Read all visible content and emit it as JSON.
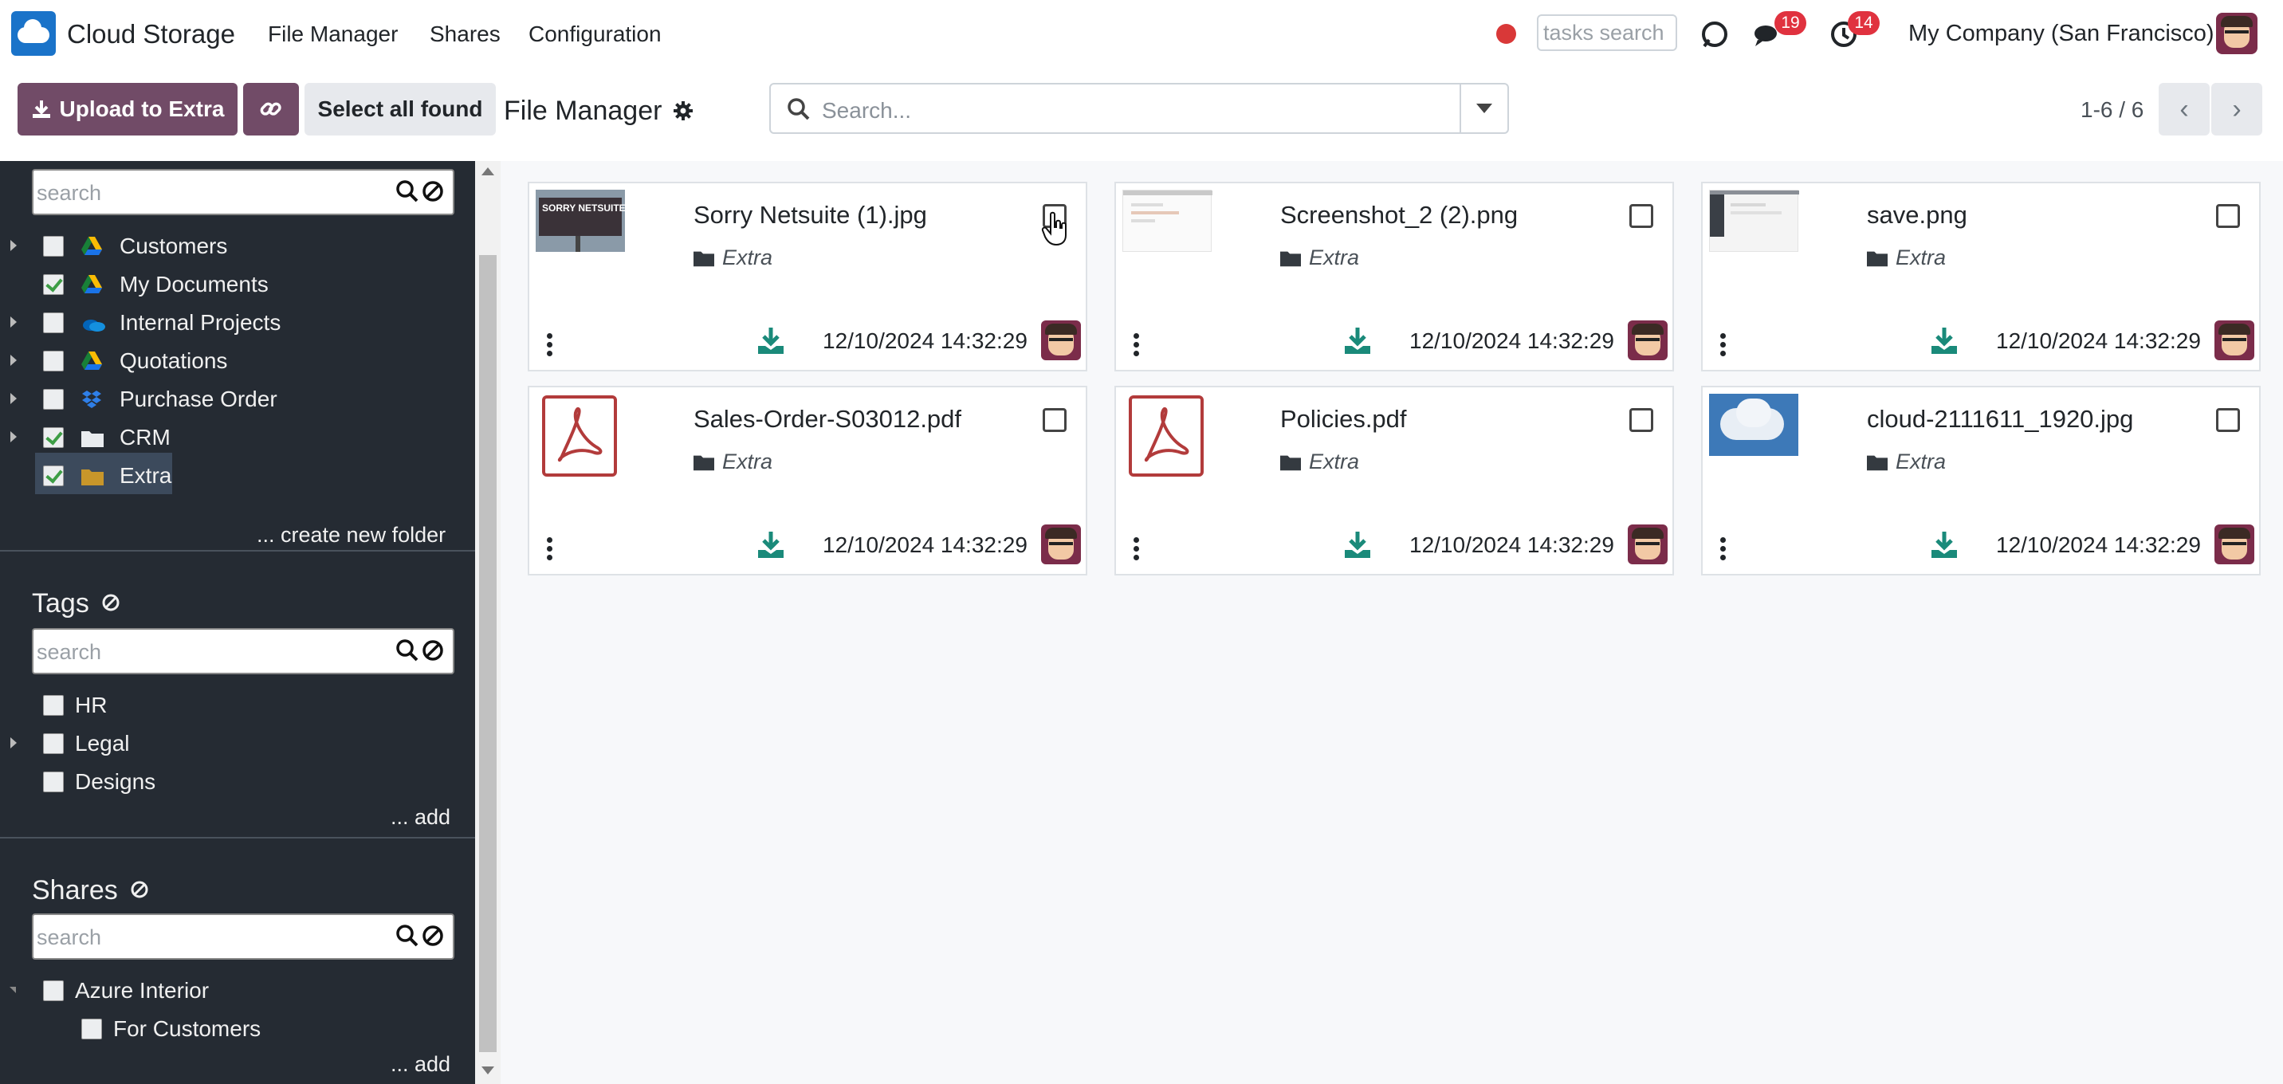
{
  "app": {
    "title": "Cloud Storage",
    "menu": [
      "File Manager",
      "Shares",
      "Configuration"
    ],
    "tasks_search_placeholder": "tasks search",
    "messages_badge": "19",
    "activities_badge": "14",
    "company": "My Company (San Francisco)"
  },
  "control": {
    "upload_label": "Upload to Extra",
    "select_all_label": "Select all found",
    "breadcrumb": "File Manager",
    "search_placeholder": "Search...",
    "pager": "1-6 / 6"
  },
  "sidebar": {
    "folder_search_placeholder": "search",
    "folders": [
      {
        "label": "Customers",
        "checked": false,
        "icon": "google-drive-icon"
      },
      {
        "label": "My Documents",
        "checked": true,
        "icon": "google-drive-icon"
      },
      {
        "label": "Internal Projects",
        "checked": false,
        "icon": "onedrive-icon"
      },
      {
        "label": "Quotations",
        "checked": false,
        "icon": "google-drive-icon"
      },
      {
        "label": "Purchase Order",
        "checked": false,
        "icon": "dropbox-icon"
      },
      {
        "label": "CRM",
        "checked": true,
        "icon": "folder-icon"
      },
      {
        "label": "Extra",
        "checked": true,
        "icon": "folder-icon"
      }
    ],
    "create_folder_label": "... create new folder",
    "tags_heading": "Tags",
    "tags_search_placeholder": "search",
    "tags": [
      "HR",
      "Legal",
      "Designs"
    ],
    "tags_add_label": "... add",
    "shares_heading": "Shares",
    "shares_search_placeholder": "search",
    "shares": [
      "Azure Interior",
      "For Customers"
    ],
    "shares_add_label": "... add"
  },
  "files": [
    {
      "name": "Sorry Netsuite (1).jpg",
      "folder": "Extra",
      "date": "12/10/2024 14:32:29",
      "thumb": "billboard",
      "thumb_text": "SORRY NETSUITE"
    },
    {
      "name": "Screenshot_2 (2).png",
      "folder": "Extra",
      "date": "12/10/2024 14:32:29",
      "thumb": "screenshot"
    },
    {
      "name": "save.png",
      "folder": "Extra",
      "date": "12/10/2024 14:32:29",
      "thumb": "screenshot-dark"
    },
    {
      "name": "Sales-Order-S03012.pdf",
      "folder": "Extra",
      "date": "12/10/2024 14:32:29",
      "thumb": "pdf"
    },
    {
      "name": "Policies.pdf",
      "folder": "Extra",
      "date": "12/10/2024 14:32:29",
      "thumb": "pdf"
    },
    {
      "name": "cloud-2111611_1920.jpg",
      "folder": "Extra",
      "date": "12/10/2024 14:32:29",
      "thumb": "sky"
    }
  ],
  "colors": {
    "brand": "#714b67",
    "sidebar_bg": "#252b33",
    "download": "#1a8a7a",
    "badge": "#e0323f"
  }
}
